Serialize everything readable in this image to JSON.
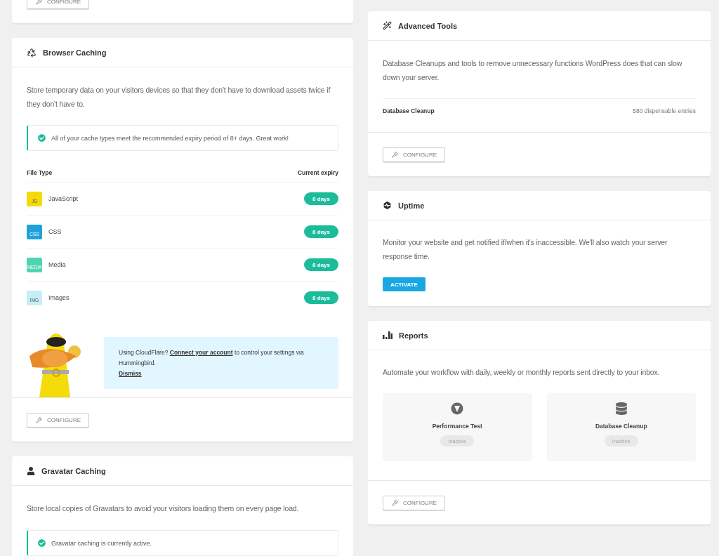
{
  "top_card": {
    "button": "CONFIGURE"
  },
  "browser_caching": {
    "title": "Browser Caching",
    "description": "Store temporary data on your visitors devices so that they don't have to download assets twice if they don't have to.",
    "notice": "All of your cache types meet the recommended expiry period of 8+ days. Great work!",
    "columns": [
      "File Type",
      "Current expiry"
    ],
    "rows": [
      {
        "badge": "JS",
        "color": "#f5d90a",
        "name": "JavaScript",
        "expiry": "8 days"
      },
      {
        "badge": "CSS",
        "color": "#1fa2d9",
        "name": "CSS",
        "expiry": "8 days"
      },
      {
        "badge": "MEDIA",
        "color": "#4fd3b0",
        "name": "Media",
        "expiry": "8 days"
      },
      {
        "badge": "IMG",
        "color": "#c6eef6",
        "name": "Images",
        "expiry": "8 days"
      }
    ],
    "cloudflare": {
      "prefix": "Using CloudFlare?",
      "link": "Connect your account",
      "suffix": "to control your settings via Hummingbird.",
      "dismiss": "Dismiss"
    },
    "button": "CONFIGURE"
  },
  "gravatar_caching": {
    "title": "Gravatar Caching",
    "description": "Store local copies of Gravatars to avoid your visitors loading them on every page load.",
    "notice": "Gravatar caching is currently active."
  },
  "advanced_tools": {
    "title": "Advanced Tools",
    "description": "Database Cleanups and tools to remove unnecessary functions WordPress does that can slow down your server.",
    "row": {
      "label": "Database Cleanup",
      "value": "580 dispensable entries"
    },
    "button": "CONFIGURE"
  },
  "uptime": {
    "title": "Uptime",
    "description": "Monitor your website and get notified if/when it's inaccessible. We'll also watch your server response time.",
    "button": "ACTIVATE"
  },
  "reports": {
    "title": "Reports",
    "description": "Automate your workflow with daily, weekly or monthly reports sent directly to your inbox.",
    "items": [
      {
        "kind": "performance",
        "title": "Performance Test",
        "status": "Inactive"
      },
      {
        "kind": "database",
        "title": "Database Cleanup",
        "status": "Inactive"
      }
    ],
    "button": "CONFIGURE"
  }
}
